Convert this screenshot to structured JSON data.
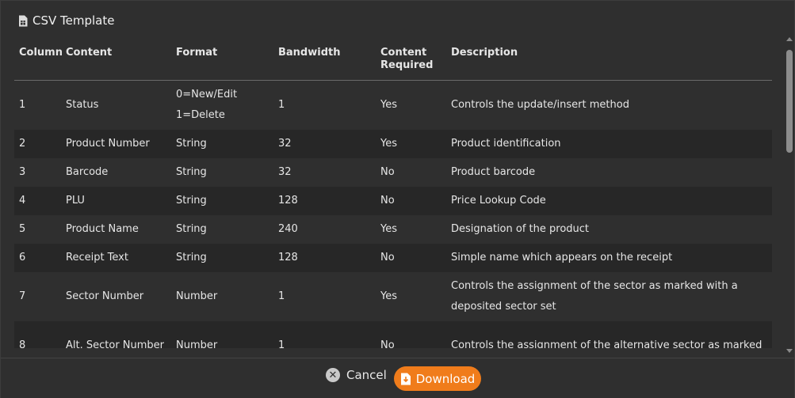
{
  "dialog": {
    "title": "CSV Template",
    "icon": "csv-file-icon"
  },
  "table": {
    "headers": [
      "Column",
      "Content",
      "Format",
      "Bandwidth",
      "Content\nRequired",
      "Description"
    ],
    "rows": [
      {
        "column": "1",
        "content": "Status",
        "format": "0=New/Edit\n1=Delete",
        "bandwidth": "1",
        "required": "Yes",
        "description": "Controls the update/insert method"
      },
      {
        "column": "2",
        "content": "Product Number",
        "format": "String",
        "bandwidth": "32",
        "required": "Yes",
        "description": "Product identification"
      },
      {
        "column": "3",
        "content": "Barcode",
        "format": "String",
        "bandwidth": "32",
        "required": "No",
        "description": "Product barcode"
      },
      {
        "column": "4",
        "content": "PLU",
        "format": "String",
        "bandwidth": "128",
        "required": "No",
        "description": "Price Lookup Code"
      },
      {
        "column": "5",
        "content": "Product Name",
        "format": "String",
        "bandwidth": "240",
        "required": "Yes",
        "description": "Designation of the product"
      },
      {
        "column": "6",
        "content": "Receipt Text",
        "format": "String",
        "bandwidth": "128",
        "required": "No",
        "description": "Simple name which appears on the receipt"
      },
      {
        "column": "7",
        "content": "Sector Number",
        "format": "Number",
        "bandwidth": "1",
        "required": "Yes",
        "description": "Controls the assignment of the sector as marked with a deposited sector set"
      },
      {
        "column": "8",
        "content": "Alt. Sector Number",
        "format": "Number",
        "bandwidth": "1",
        "required": "No",
        "description": "Controls the assignment of the alternative sector as marked"
      }
    ]
  },
  "footer": {
    "cancel_label": "Cancel",
    "download_label": "Download"
  },
  "colors": {
    "accent": "#f07c1b",
    "background": "#2f2f2f",
    "row_alt": "#272727"
  }
}
